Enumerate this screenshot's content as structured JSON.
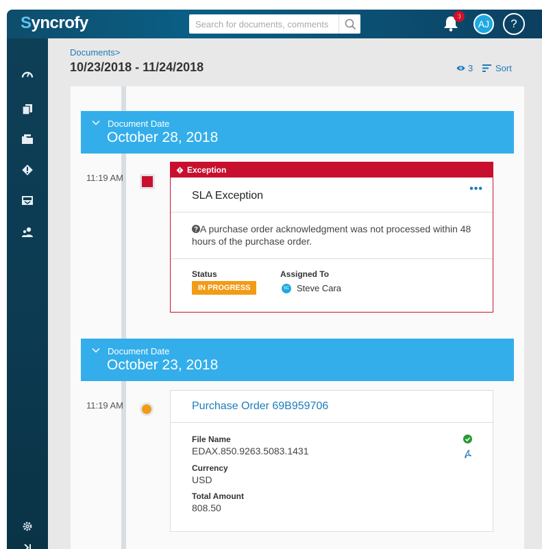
{
  "header": {
    "logo_first": "S",
    "logo_rest": "yncrofy",
    "search_placeholder": "Search for documents, comments",
    "notification_badge": ":)",
    "avatar_initials": "AJ",
    "help_label": "?"
  },
  "sidebar": {
    "icons": [
      "dashboard-icon",
      "documents-icon",
      "folders-icon",
      "exceptions-icon",
      "inbox-tray-icon",
      "contacts-icon",
      "settings-icon",
      "collapse-icon"
    ]
  },
  "page": {
    "breadcrumb": "Documents>",
    "date_range": "10/23/2018 - 11/24/2018",
    "views_count": "3",
    "sort_label": "Sort"
  },
  "timeline": [
    {
      "date_label": "Document Date",
      "date": "October 28, 2018",
      "time": "11:19 AM",
      "card": {
        "type_label": "Exception",
        "title": "SLA Exception",
        "menu": "•••",
        "description": "A purchase order acknowledgment was not processed within 48 hours of the purchase order.",
        "status_label": "Status",
        "status": "IN PROGRESS",
        "assigned_label": "Assigned To",
        "assignee_initials": "SC",
        "assignee": "Steve Cara"
      }
    },
    {
      "date_label": "Document Date",
      "date": "October 23, 2018",
      "time": "11:19 AM",
      "card": {
        "title": "Purchase Order 69B959706",
        "file_name_label": "File Name",
        "file_name": "EDAX.850.9263.5083.1431",
        "currency_label": "Currency",
        "currency": "USD",
        "total_label": "Total Amount",
        "total": "808.50"
      }
    }
  ],
  "colors": {
    "accent": "#33aeea",
    "link": "#1b7bb8",
    "exception": "#c8102e",
    "in_progress": "#f29b17",
    "topbar": "#0a5f86",
    "sidebar": "#0c3b52"
  }
}
